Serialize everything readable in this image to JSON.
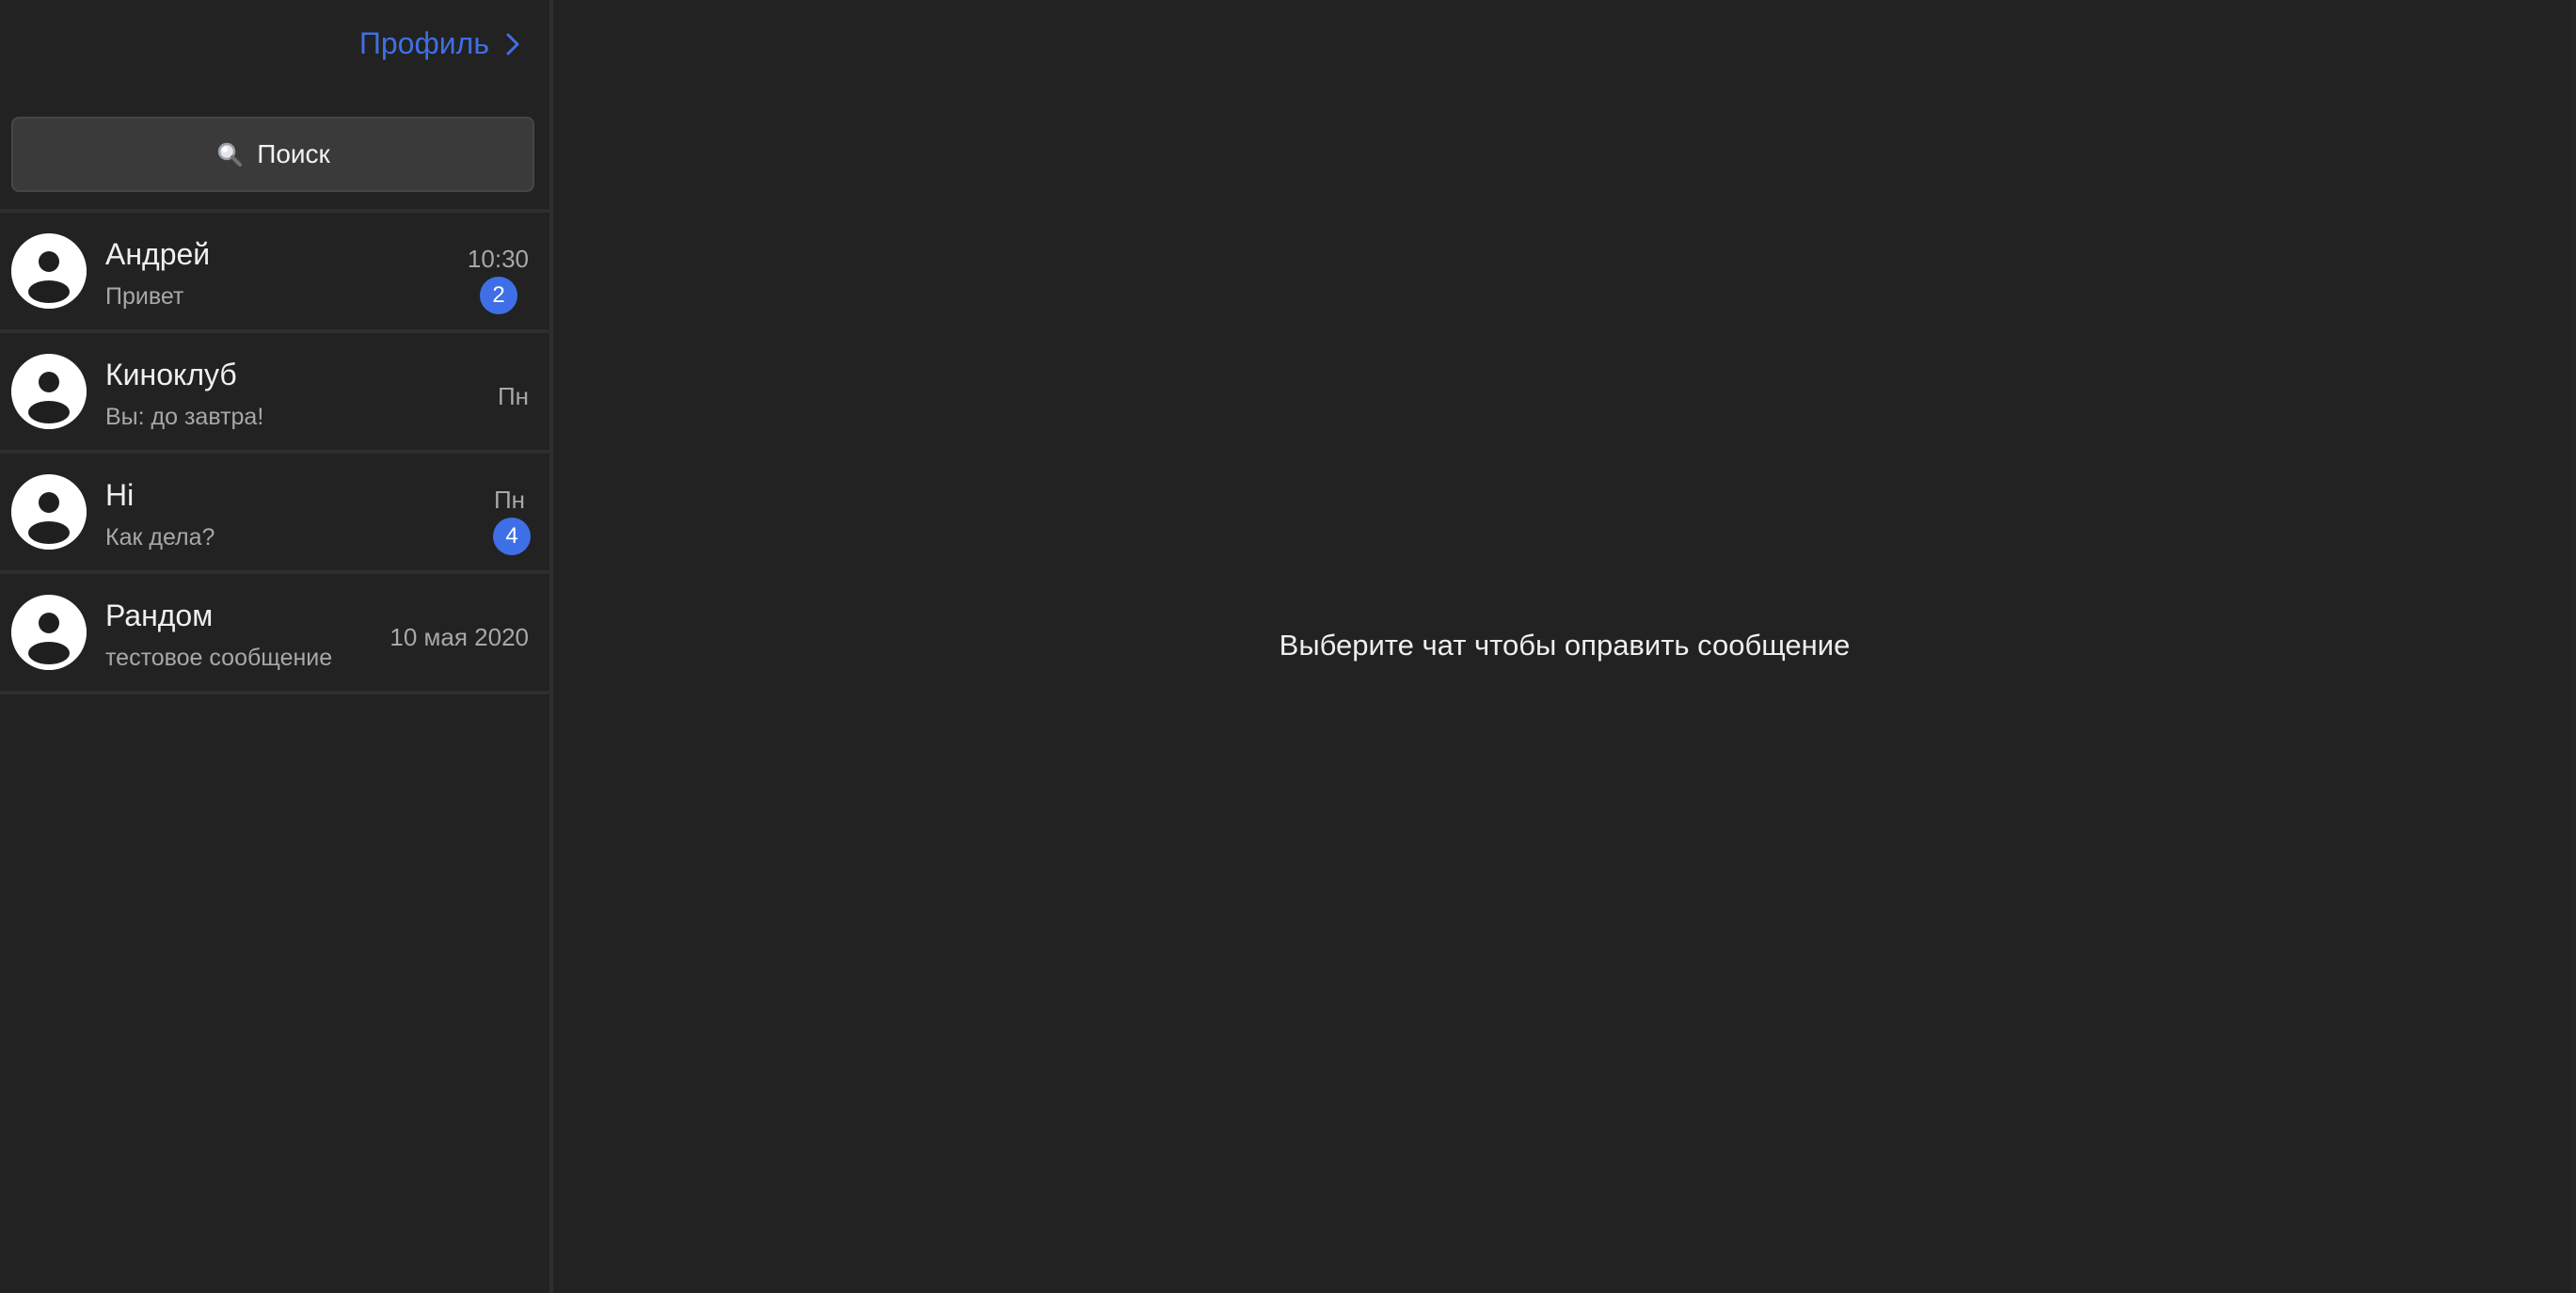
{
  "header": {
    "profile_label": "Профиль"
  },
  "search": {
    "label": "Поиск"
  },
  "chats": [
    {
      "name": "Андрей",
      "last_message": "Привет",
      "time": "10:30",
      "unread": "2"
    },
    {
      "name": "Киноклуб",
      "last_message": "Вы: до завтра!",
      "time": "Пн",
      "unread": null
    },
    {
      "name": "Hi",
      "last_message": "Как дела?",
      "time": "Пн",
      "unread": "4"
    },
    {
      "name": "Рандом",
      "last_message": "тестовое сообщение",
      "time": "10 мая 2020",
      "unread": null
    }
  ],
  "main": {
    "empty_hint": "Выберите чат чтобы оправить сообщение"
  },
  "colors": {
    "background": "#222222",
    "accent": "#3f6fe6",
    "divider": "#2e2e2e",
    "search_bg": "#3a3a3a"
  }
}
